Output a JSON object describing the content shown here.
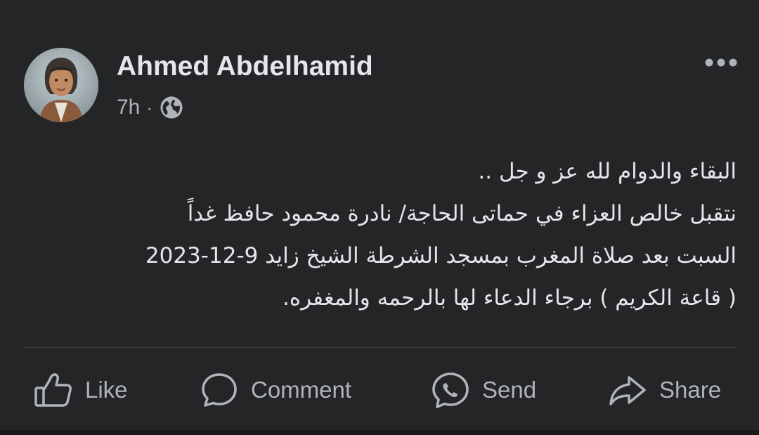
{
  "post": {
    "author": {
      "name": "Ahmed Abdelhamid",
      "avatar_icon": "profile-photo"
    },
    "meta": {
      "time": "7h",
      "separator": "·",
      "audience_icon": "globe-icon"
    },
    "more_icon": "more-horizontal-icon",
    "text_lines": [
      "البقاء والدوام لله عز و جل ..",
      "نتقبل خالص العزاء في حماتى الحاجة/ نادرة محمود حافظ غداً",
      "السبت بعد صلاة المغرب بمسجد الشرطة الشيخ زايد 9-12-2023",
      "( قاعة الكريم ) برجاء الدعاء لها بالرحمه والمغفره."
    ],
    "actions": [
      {
        "label": "Like",
        "icon": "thumbs-up-icon"
      },
      {
        "label": "Comment",
        "icon": "comment-icon"
      },
      {
        "label": "Send",
        "icon": "messenger-icon"
      },
      {
        "label": "Share",
        "icon": "share-arrow-icon"
      }
    ]
  },
  "colors": {
    "background": "#242526",
    "primary_text": "#e4e6eb",
    "secondary_text": "#b0b3b8",
    "divider": "#3e4042"
  }
}
